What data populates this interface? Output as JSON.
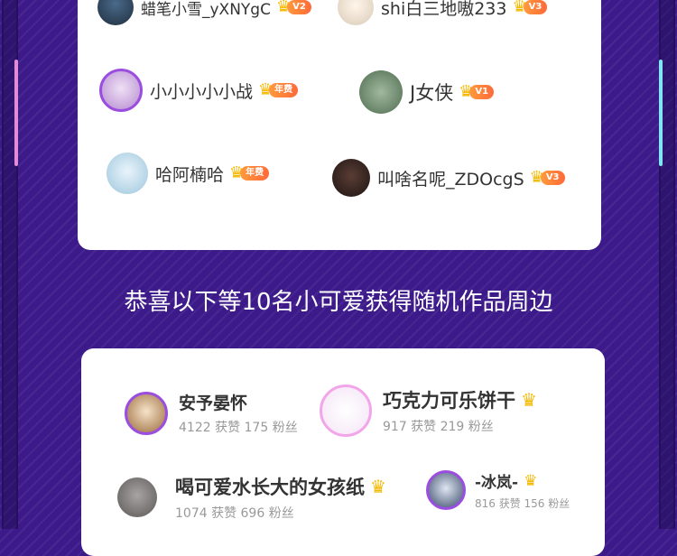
{
  "top_winners": [
    {
      "name": "蜡笔小雪_yXNYgC",
      "level": "V2"
    },
    {
      "name": "shi白三地嗷233",
      "level": "V3"
    },
    {
      "name": "小小小小小战",
      "level": "年费"
    },
    {
      "name": "J女侠",
      "level": "V1"
    },
    {
      "name": "哈阿楠哈",
      "level": "年费"
    },
    {
      "name": "叫啥名呢_ZDOcgS",
      "level": "V3"
    }
  ],
  "headline": "恭喜以下等10名小可爱获得随机作品周边",
  "bottom_winners": [
    {
      "name": "安予晏怀",
      "stats": "4122 获赞  175 粉丝"
    },
    {
      "name": "巧克力可乐饼干",
      "stats": "917 获赞  219 粉丝"
    },
    {
      "name": "喝可爱水长大的女孩纸",
      "stats": "1074 获赞  696 粉丝"
    },
    {
      "name": "-冰岚-",
      "stats": "816 获赞  156 粉丝"
    }
  ],
  "icons": {
    "crown": "crown-icon",
    "avatar": "avatar"
  },
  "colors": {
    "background": "#3d1a8a",
    "crown": "#f5b800",
    "level_badge": "#ff7a3a"
  }
}
